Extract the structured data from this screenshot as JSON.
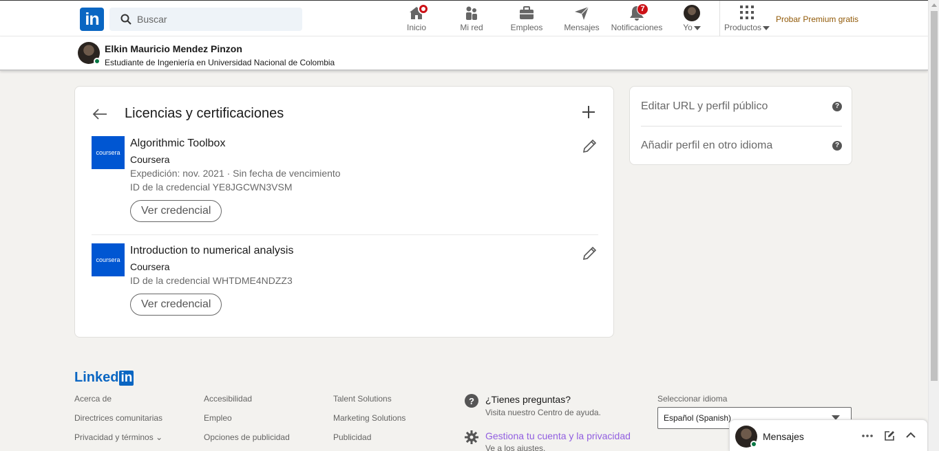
{
  "nav": {
    "search_placeholder": "Buscar",
    "items": [
      {
        "label": "Inicio",
        "icon": "home-icon"
      },
      {
        "label": "Mi red",
        "icon": "network-icon"
      },
      {
        "label": "Empleos",
        "icon": "briefcase-icon"
      },
      {
        "label": "Mensajes",
        "icon": "send-icon"
      },
      {
        "label": "Notificaciones",
        "icon": "bell-icon",
        "badge": "7"
      },
      {
        "label": "Yo",
        "icon": "avatar"
      },
      {
        "label": "Productos",
        "icon": "grid-icon"
      }
    ],
    "premium": "Probar Premium gratis",
    "accent": "#0a66c2",
    "badge_color": "#cc1016"
  },
  "profile": {
    "name": "Elkin Mauricio Mendez Pinzon",
    "headline": "Estudiante de Ingeniería en Universidad Nacional de Colombia"
  },
  "section": {
    "title": "Licencias y certificaciones",
    "certs": [
      {
        "logo": "coursera",
        "name": "Algorithmic Toolbox",
        "org": "Coursera",
        "issued": "Expedición: nov. 2021 · Sin fecha de vencimiento",
        "credential_id": "ID de la credencial YE8JGCWN3VSM",
        "button": "Ver credencial"
      },
      {
        "logo": "coursera",
        "name": "Introduction to numerical analysis",
        "org": "Coursera",
        "credential_id": "ID de la credencial WHTDME4NDZZ3",
        "button": "Ver credencial"
      }
    ]
  },
  "sidebar": {
    "items": [
      "Editar URL y perfil público",
      "Añadir perfil en otro idioma"
    ]
  },
  "footer": {
    "logo_text": "Linked",
    "logo_in": "in",
    "col1": [
      "Acerca de",
      "Directrices comunitarias",
      "Privacidad y términos"
    ],
    "col2": [
      "Accesibilidad",
      "Empleo",
      "Opciones de publicidad"
    ],
    "col3": [
      "Talent Solutions",
      "Marketing Solutions",
      "Publicidad"
    ],
    "help_title": "¿Tienes preguntas?",
    "help_sub": "Visita nuestro Centro de ayuda.",
    "manage_title": "Gestiona tu cuenta y la privacidad",
    "manage_sub": "Ve a los ajustes.",
    "lang_label": "Seleccionar idioma",
    "lang_value": "Español (Spanish)"
  },
  "messaging": {
    "title": "Mensajes"
  }
}
